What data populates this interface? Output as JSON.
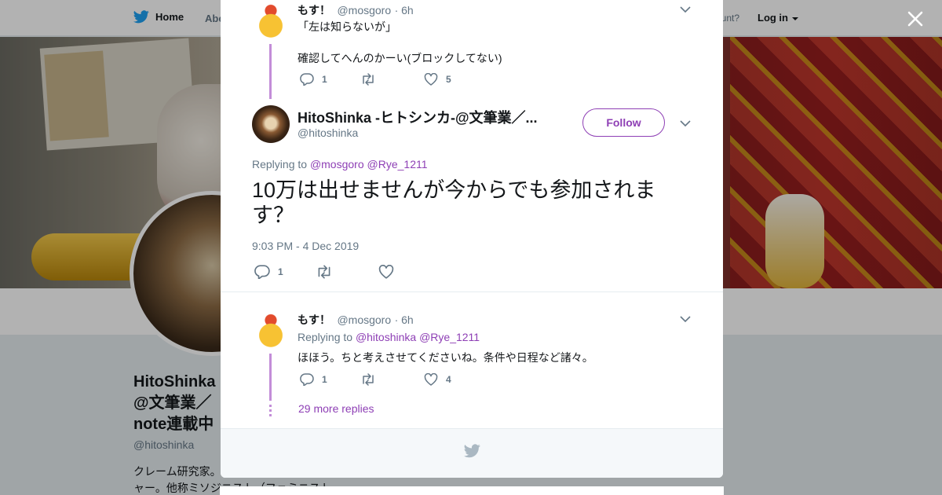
{
  "nav": {
    "home": "Home",
    "about": "Abo",
    "account_prompt": "ccount?",
    "login": "Log in"
  },
  "profile": {
    "name": "HitoShinka\n@文筆業／\nnote連載中",
    "handle": "@hitoshinka",
    "bio": "クレーム研究家。\nャー。他称ミソジニスト（フェミニスト"
  },
  "tweets": {
    "parent": {
      "name": "もす！",
      "handle": "@mosgoro",
      "time": "· 6h",
      "line1": "「左は知らないが」",
      "line2": "確認してへんのかーい(ブロックしてない)",
      "replies": "1",
      "retweets": "",
      "likes": "5"
    },
    "main": {
      "name": "HitoShinka -ヒトシンカ-@文筆業／...",
      "handle": "@hitoshinka",
      "follow": "Follow",
      "replying_prefix": "Replying to",
      "replying_users": [
        "@mosgoro",
        "@Rye_1211"
      ],
      "text": "10万は出せませんが今からでも参加されます？",
      "timestamp": "9:03 PM - 4 Dec 2019",
      "replies": "1",
      "retweets": "",
      "likes": ""
    },
    "reply": {
      "name": "もす！",
      "handle": "@mosgoro",
      "time": "· 6h",
      "replying_prefix": "Replying to",
      "replying_users": [
        "@hitoshinka",
        "@Rye_1211"
      ],
      "text": "ほほう。ちと考えさせてくださいね。条件や日程など諸々。",
      "replies": "1",
      "retweets": "",
      "likes": "4",
      "more_replies": "29 more replies"
    }
  },
  "colors": {
    "accent": "#8e3fb5",
    "thread_line": "#c38dd8",
    "muted": "#657786",
    "brand_blue": "#1da1f2"
  },
  "icons": [
    "twitter-bird-icon",
    "caret-down-icon",
    "close-icon",
    "chevron-down-icon",
    "reply-icon",
    "retweet-icon",
    "like-icon"
  ]
}
